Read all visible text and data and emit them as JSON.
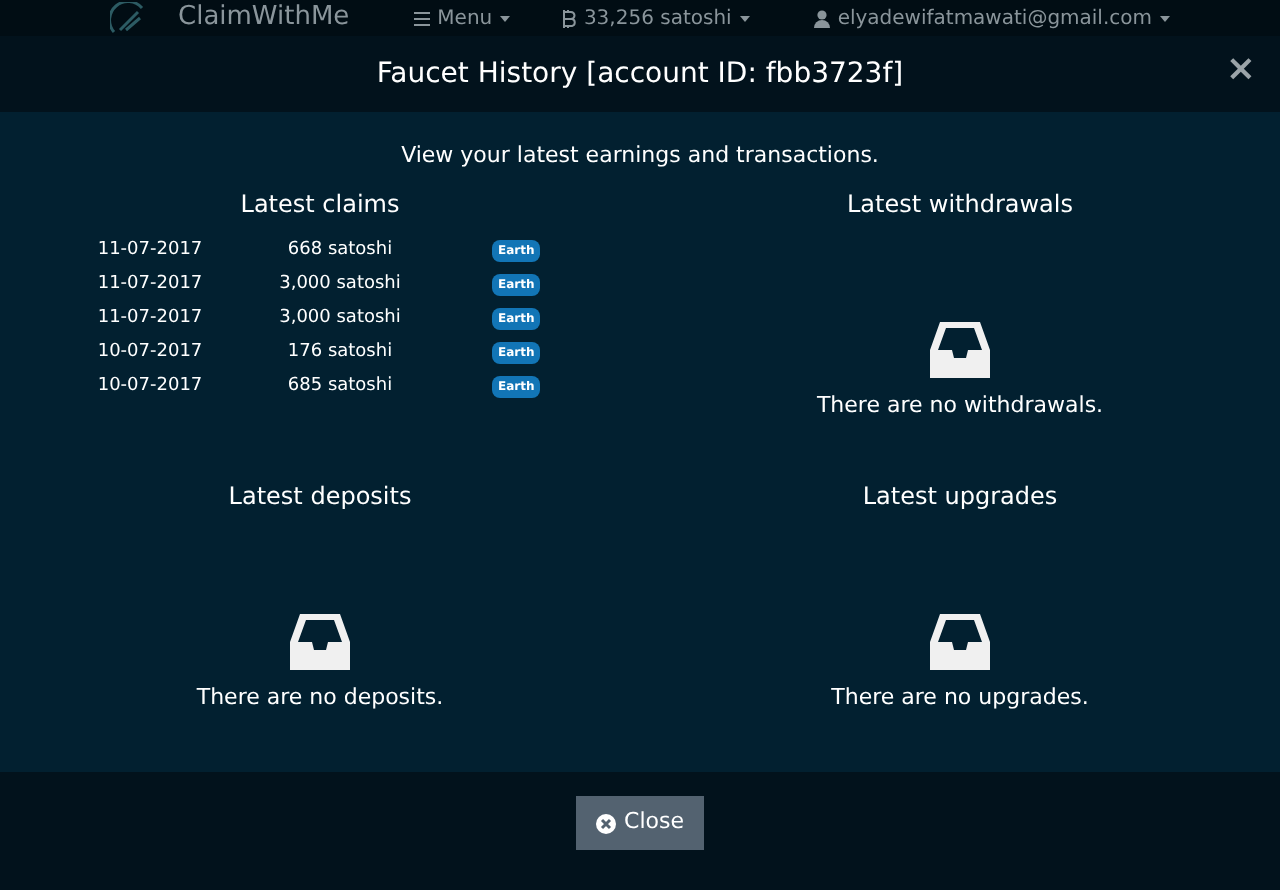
{
  "navbar": {
    "brand": "ClaimWithMe",
    "menu": "Menu",
    "balance": "33,256 satoshi",
    "account": "elyadewifatmawati@gmail.com"
  },
  "modal": {
    "title": "Faucet History [account ID: fbb3723f]",
    "close_glyph": "×",
    "intro": "View your latest earnings and transactions.",
    "sections": [
      {
        "kind": "table",
        "title": "Latest claims",
        "rows": [
          {
            "date": "11-07-2017",
            "amount": "668 satoshi",
            "tag": "Earth"
          },
          {
            "date": "11-07-2017",
            "amount": "3,000 satoshi",
            "tag": "Earth"
          },
          {
            "date": "11-07-2017",
            "amount": "3,000 satoshi",
            "tag": "Earth"
          },
          {
            "date": "10-07-2017",
            "amount": "176 satoshi",
            "tag": "Earth"
          },
          {
            "date": "10-07-2017",
            "amount": "685 satoshi",
            "tag": "Earth"
          }
        ]
      },
      {
        "kind": "empty",
        "title": "Latest withdrawals",
        "message": "There are no withdrawals."
      },
      {
        "kind": "empty",
        "title": "Latest deposits",
        "message": "There are no deposits."
      },
      {
        "kind": "empty",
        "title": "Latest upgrades",
        "message": "There are no upgrades."
      }
    ],
    "close_button": "Close"
  }
}
